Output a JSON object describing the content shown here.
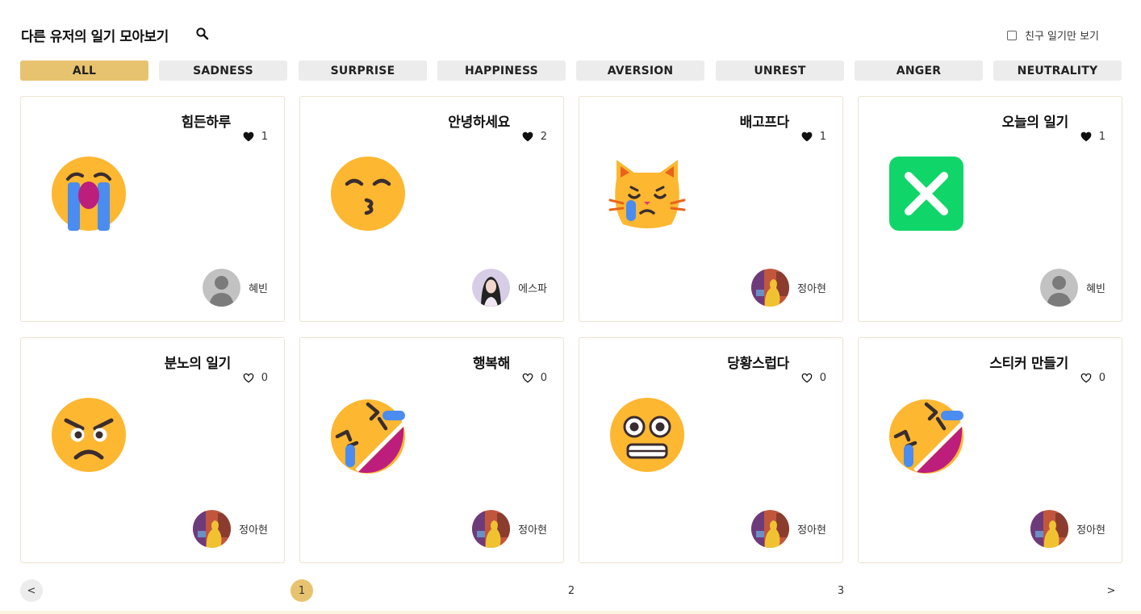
{
  "header": {
    "title": "다른 유저의 일기 모아보기",
    "search_icon": "magnifier",
    "friend_only_label": "친구 일기만 보기",
    "friend_only_checked": false
  },
  "tabs": [
    {
      "label": "ALL",
      "active": true
    },
    {
      "label": "SADNESS",
      "active": false
    },
    {
      "label": "SURPRISE",
      "active": false
    },
    {
      "label": "HAPPINESS",
      "active": false
    },
    {
      "label": "AVERSION",
      "active": false
    },
    {
      "label": "UNREST",
      "active": false
    },
    {
      "label": "ANGER",
      "active": false
    },
    {
      "label": "NEUTRALITY",
      "active": false
    }
  ],
  "diaries": [
    {
      "title": "힘든하루",
      "likes": "1",
      "liked": true,
      "emoji": "loudly-crying-face",
      "author": "혜빈",
      "avatar": "default-person"
    },
    {
      "title": "안녕하세요",
      "likes": "2",
      "liked": true,
      "emoji": "kissing-face-closed-eyes",
      "author": "에스파",
      "avatar": "profile-photo"
    },
    {
      "title": "배고프다",
      "likes": "1",
      "liked": true,
      "emoji": "crying-cat",
      "author": "정아현",
      "avatar": "illustration"
    },
    {
      "title": "오늘의 일기",
      "likes": "1",
      "liked": true,
      "emoji": "cross-mark-button",
      "author": "혜빈",
      "avatar": "default-person"
    },
    {
      "title": "분노의 일기",
      "likes": "0",
      "liked": false,
      "emoji": "angry-face",
      "author": "정아현",
      "avatar": "illustration"
    },
    {
      "title": "행복해",
      "likes": "0",
      "liked": false,
      "emoji": "rolling-on-floor-laughing",
      "author": "정아현",
      "avatar": "illustration"
    },
    {
      "title": "당황스럽다",
      "likes": "0",
      "liked": false,
      "emoji": "grimacing-face",
      "author": "정아현",
      "avatar": "illustration"
    },
    {
      "title": "스티커 만들기",
      "likes": "0",
      "liked": false,
      "emoji": "rolling-on-floor-laughing",
      "author": "정아현",
      "avatar": "illustration"
    }
  ],
  "pagination": {
    "prev": "<",
    "pages": [
      "1",
      "2",
      "3"
    ],
    "current": "1",
    "next": ">"
  },
  "colors": {
    "accent": "#e8c36f",
    "tab_bg": "#ececec",
    "card_border": "#ede3cf",
    "emoji_yellow": "#fdb731",
    "tear_blue": "#4a8cf0",
    "mouth_magenta": "#bd1e7c",
    "cross_green": "#10d66a"
  }
}
